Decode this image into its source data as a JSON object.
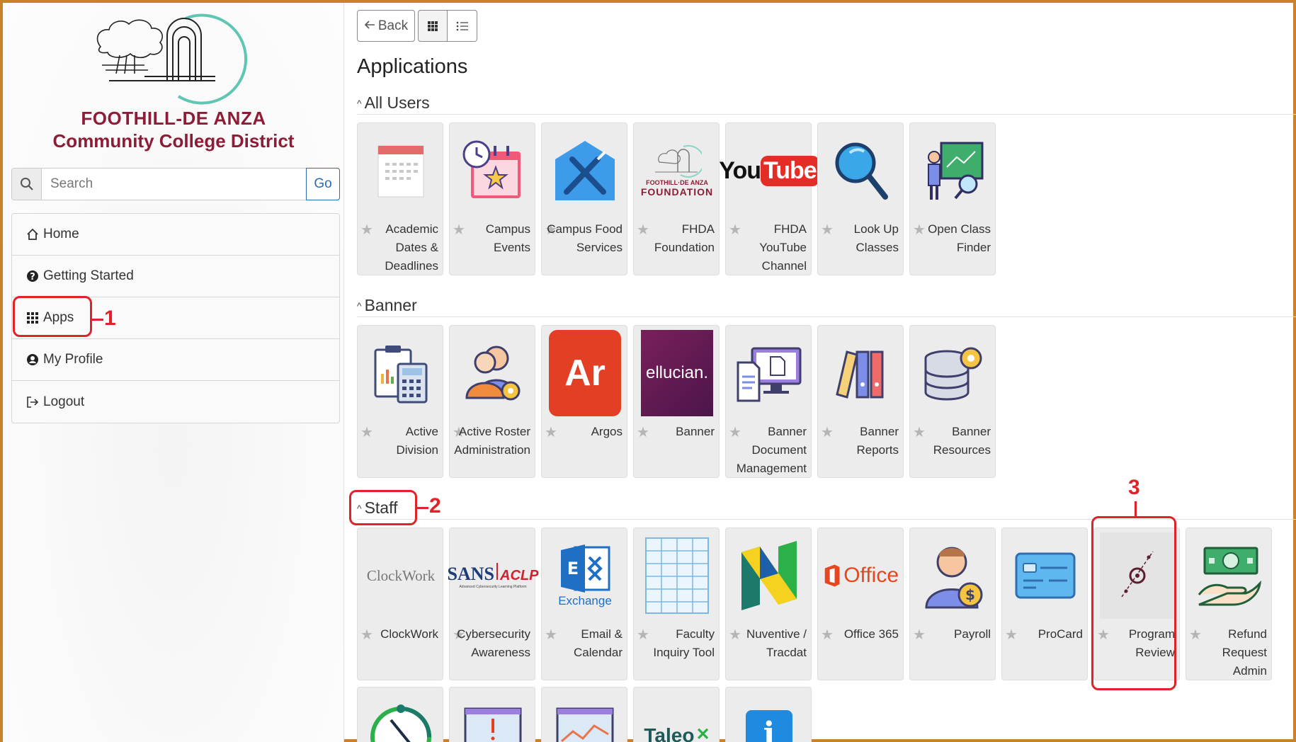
{
  "logo": {
    "line1": "FOOTHILL-DE ANZA",
    "line2": "Community College District"
  },
  "search": {
    "placeholder": "Search",
    "go_label": "Go"
  },
  "nav": [
    {
      "label": "Home",
      "icon": "home-icon"
    },
    {
      "label": "Getting Started",
      "icon": "question-circle-icon"
    },
    {
      "label": "Apps",
      "icon": "grid-icon"
    },
    {
      "label": "My Profile",
      "icon": "user-circle-icon"
    },
    {
      "label": "Logout",
      "icon": "logout-icon"
    }
  ],
  "toolbar": {
    "back_label": "Back"
  },
  "page_title": "Applications",
  "sections": {
    "all_users": {
      "title": "All Users",
      "tiles": [
        {
          "label": "Academic Dates & Deadlines",
          "icon": "calendar-icon"
        },
        {
          "label": "Campus Events",
          "icon": "event-calendar-icon"
        },
        {
          "label": "Campus Food Services",
          "icon": "fork-knife-icon"
        },
        {
          "label": "FHDA Foundation",
          "icon": "foundation-logo",
          "logo_text": "FOOTHILL·DE ANZA",
          "logo_sub": "FOUNDATION"
        },
        {
          "label": "FHDA YouTube Channel",
          "icon": "youtube-logo",
          "logo_text1": "You",
          "logo_text2": "Tube"
        },
        {
          "label": "Look Up Classes",
          "icon": "magnifier-icon"
        },
        {
          "label": "Open Class Finder",
          "icon": "presenter-icon"
        }
      ]
    },
    "banner": {
      "title": "Banner",
      "tiles": [
        {
          "label": "Active Division",
          "icon": "clipboard-calculator-icon"
        },
        {
          "label": "Active Roster Administration",
          "icon": "users-gear-icon"
        },
        {
          "label": "Argos",
          "icon": "argos-logo",
          "logo_text": "Ar"
        },
        {
          "label": "Banner",
          "icon": "ellucian-logo",
          "logo_text": "ellucian."
        },
        {
          "label": "Banner Document Management",
          "icon": "document-monitor-icon"
        },
        {
          "label": "Banner Reports",
          "icon": "binders-icon"
        },
        {
          "label": "Banner Resources",
          "icon": "database-gear-icon"
        }
      ]
    },
    "staff": {
      "title": "Staff",
      "tiles": [
        {
          "label": "ClockWork",
          "icon": "clockwork-logo",
          "logo_text": "ClockWork"
        },
        {
          "label": "Cybersecurity Awareness",
          "icon": "sans-aclp-logo",
          "logo_text1": "SANS",
          "logo_text2": "ACLP",
          "logo_sub": "Advanced Cybersecurity Learning Platform"
        },
        {
          "label": "Email & Calendar",
          "icon": "exchange-logo",
          "logo_text": "Exchange"
        },
        {
          "label": "Faculty Inquiry Tool",
          "icon": "table-grid-icon"
        },
        {
          "label": "Nuventive / Tracdat",
          "icon": "nuventive-logo"
        },
        {
          "label": "Office 365",
          "icon": "office-logo",
          "logo_text": "Office"
        },
        {
          "label": "Payroll",
          "icon": "payroll-icon"
        },
        {
          "label": "ProCard",
          "icon": "credit-card-icon"
        },
        {
          "label": "Program Review",
          "icon": "program-review-icon"
        },
        {
          "label": "Refund Request Admin",
          "icon": "refund-hand-icon"
        }
      ],
      "row2": [
        {
          "icon": "gauge-icon"
        },
        {
          "icon": "alert-board-icon"
        },
        {
          "icon": "analytics-board-icon"
        },
        {
          "icon": "taleo-logo",
          "logo_text": "Taleo"
        },
        {
          "icon": "info-icon"
        }
      ]
    }
  },
  "annotations": [
    "1",
    "2",
    "3"
  ],
  "colors": {
    "brand": "#8d1d36",
    "annotation": "#e0232a",
    "frame": "#c8822e",
    "tile_bg": "#ececec"
  }
}
